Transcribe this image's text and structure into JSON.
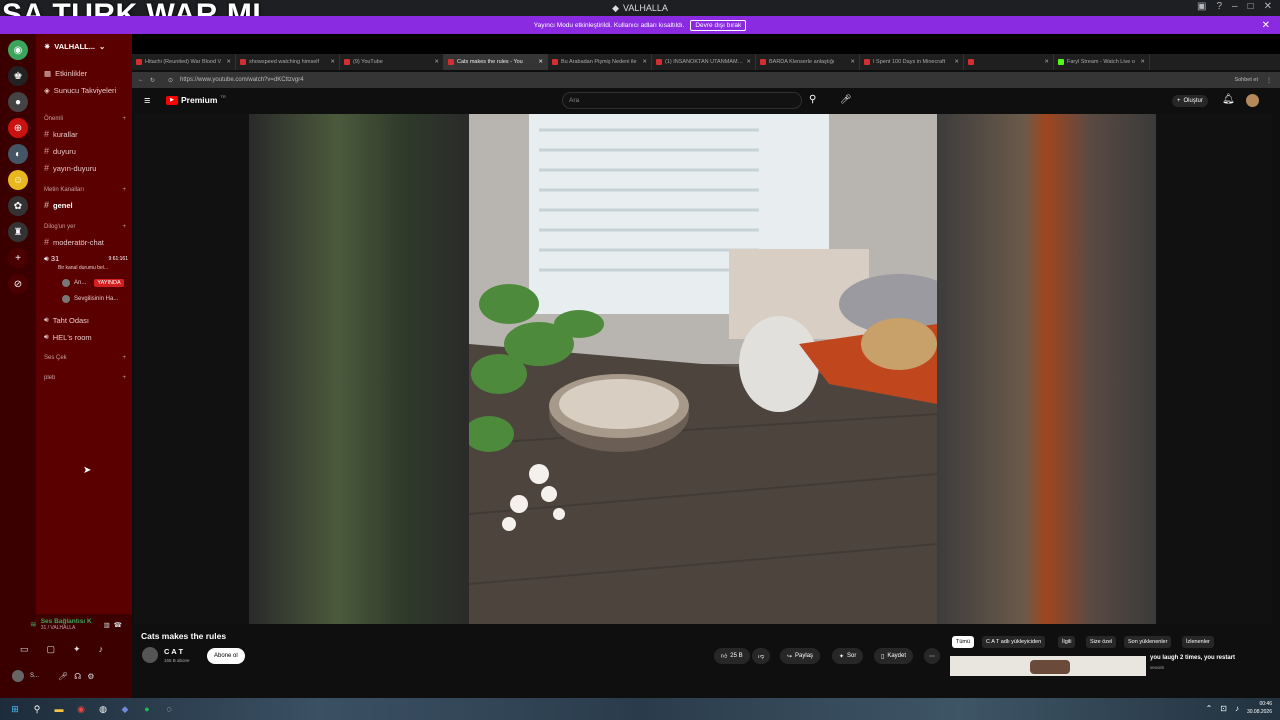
{
  "overlay_text": "SA TURK WAR MI",
  "window": {
    "title": "VALHALLA"
  },
  "banner": {
    "text": "Yayıncı Modu etkinleştirildi. Kullanıcı adları kısaltıldı.",
    "button": "Devre dışı bırak"
  },
  "server": {
    "name": "VALHALL..."
  },
  "channels": {
    "top": [
      "Etkinlikler",
      "Sunucu Takviyeleri"
    ],
    "categories": [
      {
        "name": "Önemli",
        "items": [
          "kurallar",
          "duyuru",
          "yayın-duyuru"
        ]
      },
      {
        "name": "Metin Kanalları",
        "items": [
          "genel"
        ]
      },
      {
        "name": "Dilog'un yer",
        "items": [
          "moderatör-chat"
        ]
      },
      {
        "name": "Ses Çek",
        "items": []
      },
      {
        "name": "pleb",
        "items": []
      }
    ],
    "voice_31": {
      "name": "31",
      "time": "9:61:161",
      "status": "Bir kanal durumu bel...",
      "users": [
        {
          "name": "An...",
          "badge": "YAYINDA"
        },
        {
          "name": "Sevgilisinin Ha..."
        }
      ]
    },
    "voice_rooms": [
      "Taht Odası",
      "HEL's room"
    ]
  },
  "voice_status": {
    "title": "Ses Bağlantısı K",
    "sub": "31 / VALHALLA"
  },
  "user": {
    "name": "S..."
  },
  "tabs": [
    {
      "label": "Hitachi (Reunited) War Blood V",
      "color": "#d32f2f"
    },
    {
      "label": "showspeed watching himself",
      "color": "#d32f2f"
    },
    {
      "label": "(9) YouTube",
      "color": "#d32f2f"
    },
    {
      "label": "Cats makes the rules - You",
      "color": "#d32f2f",
      "active": true
    },
    {
      "label": "Bu Arabadan Pişmiş Nedeni ile",
      "color": "#d32f2f"
    },
    {
      "label": "(1) İNSANOKTAN UTANMAMAK",
      "color": "#d32f2f"
    },
    {
      "label": "BARDA Klenserle anlaştığı",
      "color": "#d32f2f"
    },
    {
      "label": "I Spent 100 Days in Minecraft",
      "color": "#d32f2f"
    },
    {
      "label": "",
      "color": "#d32f2f"
    },
    {
      "label": "Faryl Stream - Watch Live o",
      "color": "#53fc18"
    }
  ],
  "address": {
    "url": "https://www.youtube.com/watch?v=dKCttzvgr4",
    "profile": "Sohbet et"
  },
  "youtube": {
    "logo": "Premium",
    "logo_sup": "TR",
    "search_placeholder": "Ara",
    "create": "Oluştur",
    "video_title": "Cats makes the rules",
    "channel": "C A T",
    "subs": "165 B abone",
    "subscribe": "Abone ol",
    "likes": "25 B",
    "share": "Paylaş",
    "ask": "Sor",
    "save": "Kaydet",
    "chips": [
      "Tümü",
      "C A T adlı yükleyiciden",
      "İlgili",
      "Size özel",
      "Son yüklenenler",
      "İzlenenler"
    ],
    "rec_title": "you laugh 2 times, you restart",
    "rec_sub": "vexoim"
  },
  "taskbar": {
    "time": "00:46",
    "date": "30.08.2026"
  }
}
